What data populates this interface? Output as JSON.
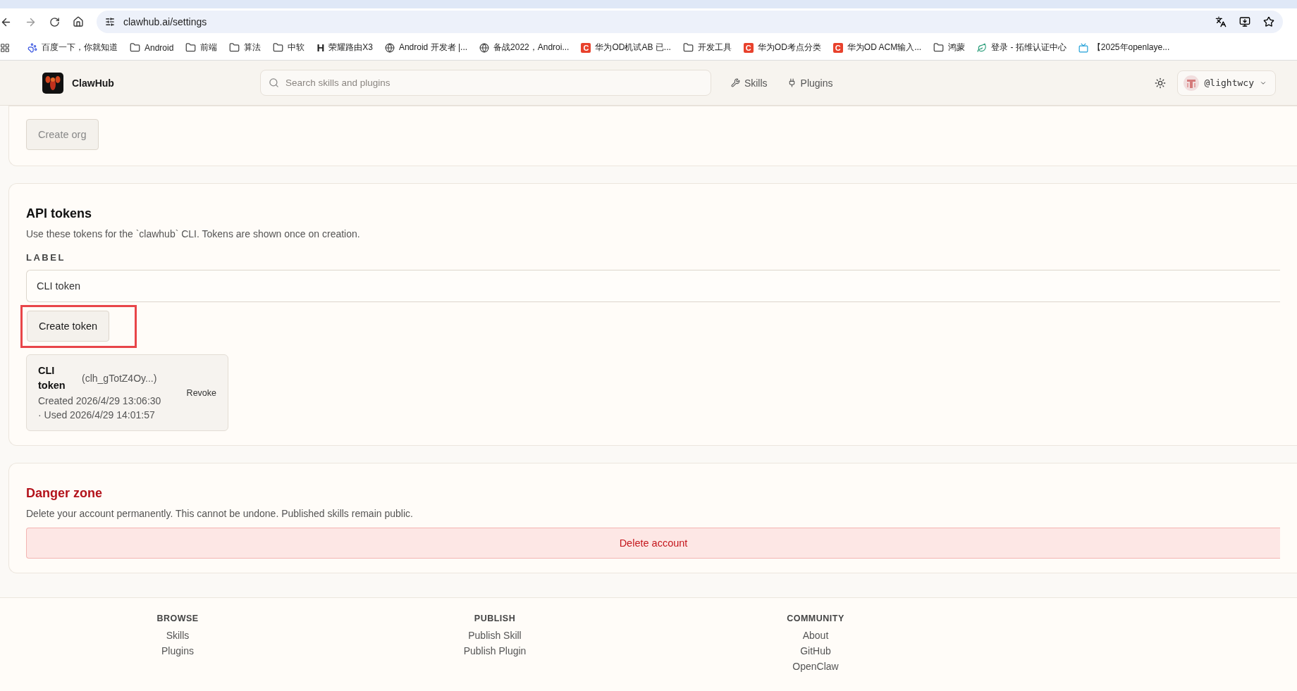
{
  "browser": {
    "url": "clawhub.ai/settings",
    "bookmarks": [
      {
        "label": "百度一下，你就知道",
        "kind": "paw"
      },
      {
        "label": "Android",
        "kind": "folder"
      },
      {
        "label": "前端",
        "kind": "folder"
      },
      {
        "label": "算法",
        "kind": "folder"
      },
      {
        "label": "中软",
        "kind": "folder"
      },
      {
        "label": "荣耀路由X3",
        "kind": "letter",
        "badge": "H"
      },
      {
        "label": "Android 开发者 |...",
        "kind": "globe"
      },
      {
        "label": "备战2022，Androi...",
        "kind": "globe"
      },
      {
        "label": "华为OD机试AB 已...",
        "kind": "letter-tile",
        "badge": "C"
      },
      {
        "label": "开发工具",
        "kind": "folder"
      },
      {
        "label": "华为OD考点分类",
        "kind": "letter-tile",
        "badge": "C"
      },
      {
        "label": "华为OD ACM输入...",
        "kind": "letter-tile",
        "badge": "C"
      },
      {
        "label": "鸿蒙",
        "kind": "folder"
      },
      {
        "label": "登录 - 拓维认证中心",
        "kind": "leaf"
      },
      {
        "label": "【2025年openlaye...",
        "kind": "tv"
      }
    ]
  },
  "header": {
    "brand": "ClawHub",
    "search": {
      "placeholder": "Search skills and plugins"
    },
    "nav": [
      {
        "label": "Skills",
        "kind": "wrench"
      },
      {
        "label": "Plugins",
        "kind": "plug"
      }
    ],
    "user": "@lightwcy"
  },
  "org_section": {
    "button": "Create org"
  },
  "api_tokens": {
    "title": "API tokens",
    "description": "Use these tokens for the `clawhub` CLI. Tokens are shown once on creation.",
    "field_label": "LABEL",
    "field_value": "CLI token",
    "button": "Create token",
    "highlighted": true,
    "tokens": [
      {
        "name": "CLI token",
        "prefix": "(clh_gTotZ4Oy...)",
        "meta": "Created 2026/4/29 13:06:30 · Used 2026/4/29 14:01:57",
        "action": "Revoke"
      }
    ]
  },
  "danger_zone": {
    "title": "Danger zone",
    "description": "Delete your account permanently. This cannot be undone. Published skills remain public.",
    "button": "Delete account"
  },
  "footer": {
    "columns": [
      {
        "heading": "BROWSE",
        "links": [
          "Skills",
          "Plugins"
        ]
      },
      {
        "heading": "PUBLISH",
        "links": [
          "Publish Skill",
          "Publish Plugin"
        ]
      },
      {
        "heading": "COMMUNITY",
        "links": [
          "About",
          "GitHub",
          "OpenClaw"
        ]
      }
    ]
  }
}
